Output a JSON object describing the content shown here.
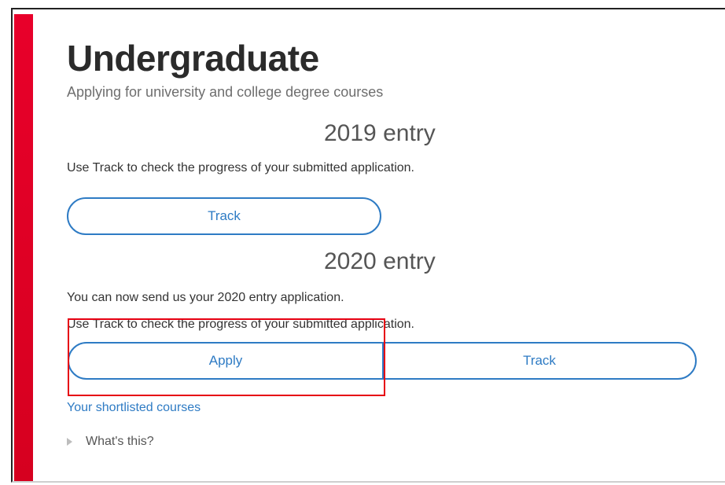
{
  "page": {
    "title": "Undergraduate",
    "subtitle": "Applying for university and college degree courses"
  },
  "entry_2019": {
    "heading": "2019 entry",
    "description": "Use Track to check the progress of your submitted application.",
    "track_label": "Track"
  },
  "entry_2020": {
    "heading": "2020 entry",
    "send_text": "You can now send us your 2020 entry application.",
    "description": "Use Track to check the progress of your submitted application.",
    "apply_label": "Apply",
    "track_label": "Track"
  },
  "links": {
    "shortlisted": "Your shortlisted courses",
    "whats_this": "What's this?"
  },
  "colors": {
    "accent_bar": "#e8002a",
    "link_blue": "#2e7bc4",
    "highlight_red": "#e60012"
  },
  "icons": {
    "disclosure": "triangle-right-icon"
  }
}
